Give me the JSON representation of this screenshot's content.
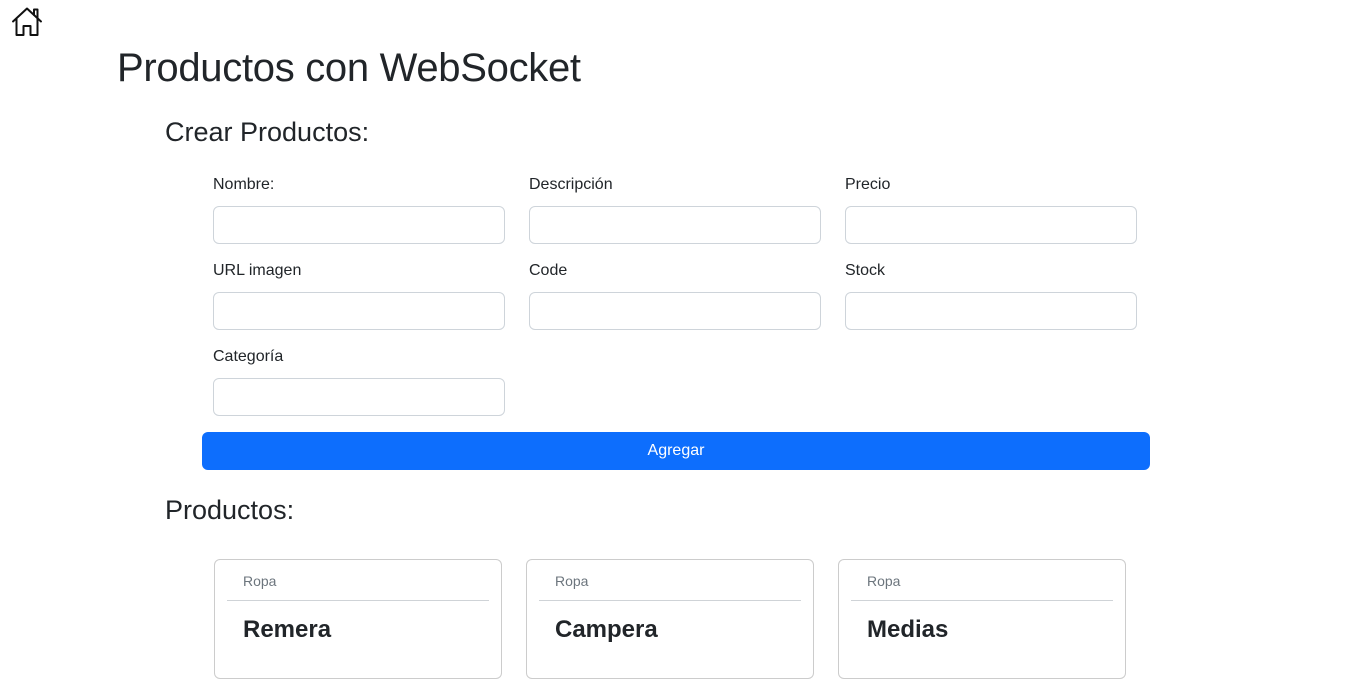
{
  "nav": {
    "home_icon": "home-icon"
  },
  "page": {
    "title": "Productos con WebSocket"
  },
  "create_section": {
    "title": "Crear Productos:",
    "fields": {
      "nombre": {
        "label": "Nombre:",
        "value": ""
      },
      "descripcion": {
        "label": "Descripción",
        "value": ""
      },
      "precio": {
        "label": "Precio",
        "value": ""
      },
      "url_imagen": {
        "label": "URL imagen",
        "value": ""
      },
      "code": {
        "label": "Code",
        "value": ""
      },
      "stock": {
        "label": "Stock",
        "value": ""
      },
      "categoria": {
        "label": "Categoría",
        "value": ""
      }
    },
    "submit_label": "Agregar"
  },
  "products_section": {
    "title": "Productos:",
    "cards": [
      {
        "category": "Ropa",
        "name": "Remera"
      },
      {
        "category": "Ropa",
        "name": "Campera"
      },
      {
        "category": "Ropa",
        "name": "Medias"
      }
    ]
  },
  "colors": {
    "primary_button": "#0d6efd",
    "text": "#212529",
    "muted_text": "#6c757d",
    "input_border": "#ced4da"
  }
}
